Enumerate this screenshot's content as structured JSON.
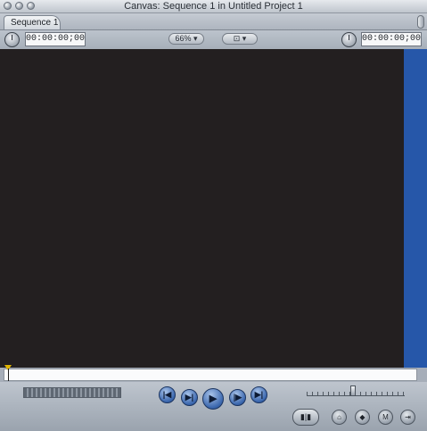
{
  "window": {
    "title": "Canvas: Sequence 1 in Untitled Project 1"
  },
  "tabs": [
    {
      "label": "Sequence 1"
    }
  ],
  "controls": {
    "timecode_duration": "00:00:00;00",
    "zoom": "66%",
    "view_menu_icon": "view-options-icon",
    "timecode_current": "00:00:00;00"
  },
  "colors": {
    "canvas_bg": "#231f20",
    "accent_bar": "#2657a9"
  },
  "transport": {
    "buttons": [
      "go-to-previous-edit-icon",
      "play-in-to-out-icon",
      "play-icon",
      "play-around-current-icon",
      "go-to-next-edit-icon"
    ],
    "glyphs": {
      "prev_edit": "|◀",
      "in_out": "▶|",
      "play": "▶",
      "around": "|▶",
      "next_edit": "▶|"
    }
  },
  "secondary_buttons": {
    "match_frame": "match-frame-icon",
    "mark_clip": "mark-clip-icon",
    "add_keyframe": "add-keyframe-icon",
    "add_marker": "add-marker-icon",
    "export": "export-icon",
    "glyphs": {
      "match": "▮|▮",
      "clip": "⌂",
      "keyframe": "◆",
      "marker": "M",
      "export": "⇥"
    }
  }
}
